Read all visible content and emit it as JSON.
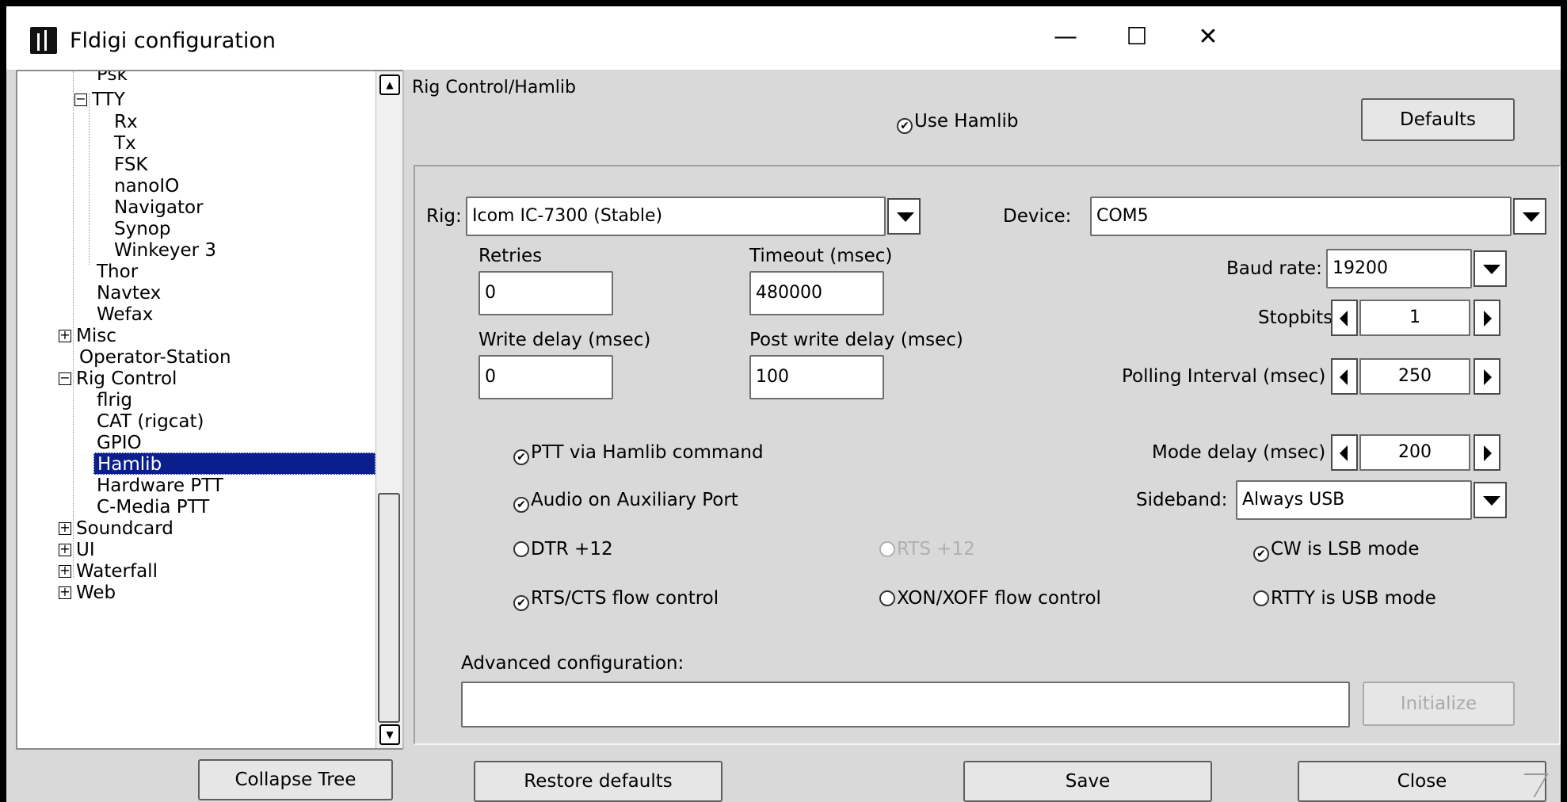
{
  "window": {
    "title": "Fldigi configuration",
    "minimize": "—",
    "maximize": "☐",
    "close": "✕"
  },
  "tree": {
    "items": [
      {
        "label": "Psk"
      },
      {
        "label": "TTY",
        "expander": "−"
      },
      {
        "label": "Rx"
      },
      {
        "label": "Tx"
      },
      {
        "label": "FSK"
      },
      {
        "label": "nanoIO"
      },
      {
        "label": "Navigator"
      },
      {
        "label": "Synop"
      },
      {
        "label": "Winkeyer 3"
      },
      {
        "label": "Thor"
      },
      {
        "label": "Navtex"
      },
      {
        "label": "Wefax"
      },
      {
        "label": "Misc",
        "expander": "+"
      },
      {
        "label": "Operator-Station"
      },
      {
        "label": "Rig Control",
        "expander": "−"
      },
      {
        "label": "flrig"
      },
      {
        "label": "CAT (rigcat)"
      },
      {
        "label": "GPIO"
      },
      {
        "label": "Hamlib"
      },
      {
        "label": "Hardware PTT"
      },
      {
        "label": "C-Media PTT"
      },
      {
        "label": "Soundcard",
        "expander": "+"
      },
      {
        "label": "UI",
        "expander": "+"
      },
      {
        "label": "Waterfall",
        "expander": "+"
      },
      {
        "label": "Web",
        "expander": "+"
      }
    ],
    "scroll_up": "▲",
    "scroll_down": "▼"
  },
  "panel": {
    "heading": "Rig Control/Hamlib",
    "use_hamlib": {
      "label": "Use Hamlib",
      "checked": true
    },
    "defaults_button": "Defaults",
    "rig": {
      "label": "Rig:",
      "value": "Icom IC-7300  (Stable)"
    },
    "device": {
      "label": "Device:",
      "value": "COM5"
    },
    "retries": {
      "label": "Retries",
      "value": "0"
    },
    "timeout": {
      "label": "Timeout (msec)",
      "value": "480000"
    },
    "baud_rate": {
      "label": "Baud rate:",
      "value": "19200"
    },
    "stopbits": {
      "label": "Stopbits",
      "value": "1"
    },
    "write_delay": {
      "label": "Write delay (msec)",
      "value": "0"
    },
    "post_write_delay": {
      "label": "Post write delay (msec)",
      "value": "100"
    },
    "polling_interval": {
      "label": "Polling Interval (msec)",
      "value": "250"
    },
    "ptt_via_hamlib": {
      "label": "PTT via Hamlib command",
      "checked": true
    },
    "mode_delay": {
      "label": "Mode delay (msec)",
      "value": "200"
    },
    "audio_aux": {
      "label": "Audio on Auxiliary Port",
      "checked": true
    },
    "sideband": {
      "label": "Sideband:",
      "value": "Always USB"
    },
    "dtr12": {
      "label": "DTR +12",
      "checked": false
    },
    "rts12": {
      "label": "RTS +12",
      "checked": false,
      "disabled": true
    },
    "cw_lsb": {
      "label": "CW is LSB mode",
      "checked": true
    },
    "rts_cts": {
      "label": "RTS/CTS flow control",
      "checked": true
    },
    "xon_xoff": {
      "label": "XON/XOFF flow control",
      "checked": false
    },
    "rtty_usb": {
      "label": "RTTY is USB mode",
      "checked": false
    },
    "advanced": {
      "label": "Advanced configuration:",
      "value": ""
    },
    "initialize_button": "Initialize",
    "check_mark": "✔"
  },
  "bottom": {
    "collapse_tree": "Collapse Tree",
    "restore_defaults": "Restore defaults",
    "save": "Save",
    "close": "Close"
  }
}
